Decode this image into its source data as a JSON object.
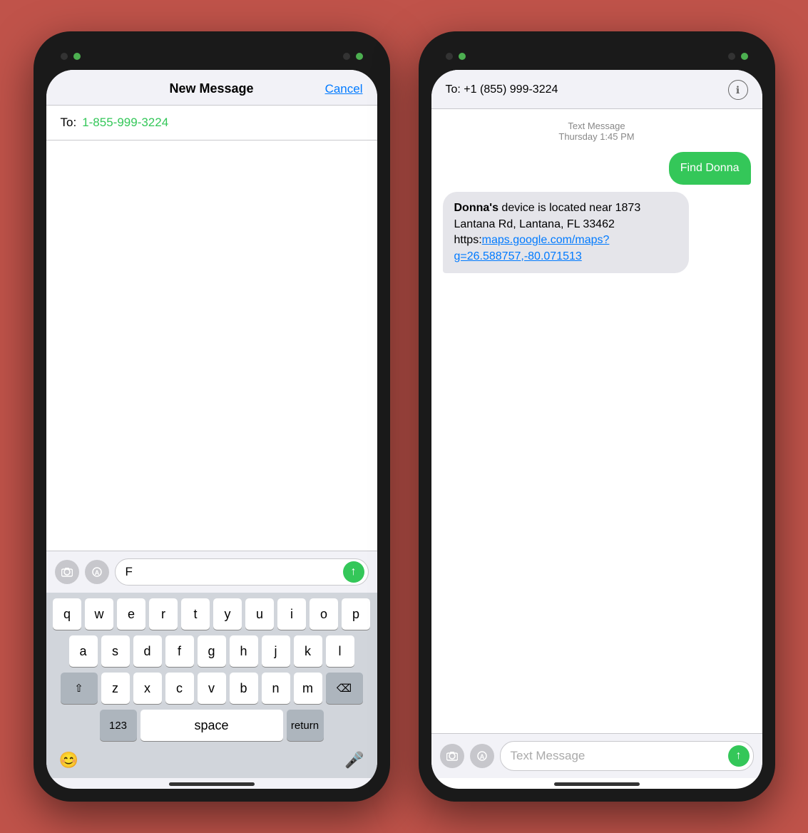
{
  "left_phone": {
    "nav": {
      "title": "New Message",
      "cancel_label": "Cancel"
    },
    "to_field": {
      "label": "To:",
      "number": "1-855-999-3224"
    },
    "input": {
      "text": "F",
      "placeholder": ""
    },
    "keyboard": {
      "rows": [
        [
          "q",
          "w",
          "e",
          "r",
          "t",
          "y",
          "u",
          "i",
          "o",
          "p"
        ],
        [
          "a",
          "s",
          "d",
          "f",
          "g",
          "h",
          "j",
          "k",
          "l"
        ],
        [
          "⇧",
          "z",
          "x",
          "c",
          "v",
          "b",
          "n",
          "m",
          "⌫"
        ],
        [
          "123",
          "space",
          "return"
        ]
      ],
      "bottom": [
        "😊",
        "🎤"
      ]
    }
  },
  "right_phone": {
    "header": {
      "to_label": "To:",
      "number": "+1 (855) 999-3224",
      "info_icon": "ℹ"
    },
    "messages": [
      {
        "type": "timestamp",
        "msg_type": "Text Message",
        "time": "Thursday 1:45 PM"
      },
      {
        "type": "sent",
        "text": "Find Donna"
      },
      {
        "type": "received",
        "text_parts": [
          "Donna's device is located near 1873 Lantana Rd, Lantana, FL 33462\nhttps://maps.google.com/maps?\ng=26.588757,-80.071513"
        ]
      }
    ],
    "input": {
      "placeholder": "Text Message"
    },
    "icons": {
      "camera": "📷",
      "apps": "🅐"
    }
  }
}
